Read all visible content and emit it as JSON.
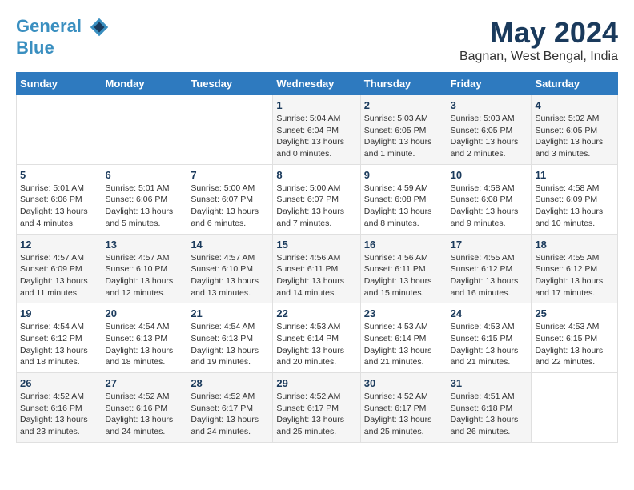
{
  "header": {
    "logo_line1": "General",
    "logo_line2": "Blue",
    "main_title": "May 2024",
    "subtitle": "Bagnan, West Bengal, India"
  },
  "weekdays": [
    "Sunday",
    "Monday",
    "Tuesday",
    "Wednesday",
    "Thursday",
    "Friday",
    "Saturday"
  ],
  "weeks": [
    [
      {
        "day": "",
        "info": ""
      },
      {
        "day": "",
        "info": ""
      },
      {
        "day": "",
        "info": ""
      },
      {
        "day": "1",
        "info": "Sunrise: 5:04 AM\nSunset: 6:04 PM\nDaylight: 13 hours and 0 minutes."
      },
      {
        "day": "2",
        "info": "Sunrise: 5:03 AM\nSunset: 6:05 PM\nDaylight: 13 hours and 1 minute."
      },
      {
        "day": "3",
        "info": "Sunrise: 5:03 AM\nSunset: 6:05 PM\nDaylight: 13 hours and 2 minutes."
      },
      {
        "day": "4",
        "info": "Sunrise: 5:02 AM\nSunset: 6:05 PM\nDaylight: 13 hours and 3 minutes."
      }
    ],
    [
      {
        "day": "5",
        "info": "Sunrise: 5:01 AM\nSunset: 6:06 PM\nDaylight: 13 hours and 4 minutes."
      },
      {
        "day": "6",
        "info": "Sunrise: 5:01 AM\nSunset: 6:06 PM\nDaylight: 13 hours and 5 minutes."
      },
      {
        "day": "7",
        "info": "Sunrise: 5:00 AM\nSunset: 6:07 PM\nDaylight: 13 hours and 6 minutes."
      },
      {
        "day": "8",
        "info": "Sunrise: 5:00 AM\nSunset: 6:07 PM\nDaylight: 13 hours and 7 minutes."
      },
      {
        "day": "9",
        "info": "Sunrise: 4:59 AM\nSunset: 6:08 PM\nDaylight: 13 hours and 8 minutes."
      },
      {
        "day": "10",
        "info": "Sunrise: 4:58 AM\nSunset: 6:08 PM\nDaylight: 13 hours and 9 minutes."
      },
      {
        "day": "11",
        "info": "Sunrise: 4:58 AM\nSunset: 6:09 PM\nDaylight: 13 hours and 10 minutes."
      }
    ],
    [
      {
        "day": "12",
        "info": "Sunrise: 4:57 AM\nSunset: 6:09 PM\nDaylight: 13 hours and 11 minutes."
      },
      {
        "day": "13",
        "info": "Sunrise: 4:57 AM\nSunset: 6:10 PM\nDaylight: 13 hours and 12 minutes."
      },
      {
        "day": "14",
        "info": "Sunrise: 4:57 AM\nSunset: 6:10 PM\nDaylight: 13 hours and 13 minutes."
      },
      {
        "day": "15",
        "info": "Sunrise: 4:56 AM\nSunset: 6:11 PM\nDaylight: 13 hours and 14 minutes."
      },
      {
        "day": "16",
        "info": "Sunrise: 4:56 AM\nSunset: 6:11 PM\nDaylight: 13 hours and 15 minutes."
      },
      {
        "day": "17",
        "info": "Sunrise: 4:55 AM\nSunset: 6:12 PM\nDaylight: 13 hours and 16 minutes."
      },
      {
        "day": "18",
        "info": "Sunrise: 4:55 AM\nSunset: 6:12 PM\nDaylight: 13 hours and 17 minutes."
      }
    ],
    [
      {
        "day": "19",
        "info": "Sunrise: 4:54 AM\nSunset: 6:12 PM\nDaylight: 13 hours and 18 minutes."
      },
      {
        "day": "20",
        "info": "Sunrise: 4:54 AM\nSunset: 6:13 PM\nDaylight: 13 hours and 18 minutes."
      },
      {
        "day": "21",
        "info": "Sunrise: 4:54 AM\nSunset: 6:13 PM\nDaylight: 13 hours and 19 minutes."
      },
      {
        "day": "22",
        "info": "Sunrise: 4:53 AM\nSunset: 6:14 PM\nDaylight: 13 hours and 20 minutes."
      },
      {
        "day": "23",
        "info": "Sunrise: 4:53 AM\nSunset: 6:14 PM\nDaylight: 13 hours and 21 minutes."
      },
      {
        "day": "24",
        "info": "Sunrise: 4:53 AM\nSunset: 6:15 PM\nDaylight: 13 hours and 21 minutes."
      },
      {
        "day": "25",
        "info": "Sunrise: 4:53 AM\nSunset: 6:15 PM\nDaylight: 13 hours and 22 minutes."
      }
    ],
    [
      {
        "day": "26",
        "info": "Sunrise: 4:52 AM\nSunset: 6:16 PM\nDaylight: 13 hours and 23 minutes."
      },
      {
        "day": "27",
        "info": "Sunrise: 4:52 AM\nSunset: 6:16 PM\nDaylight: 13 hours and 24 minutes."
      },
      {
        "day": "28",
        "info": "Sunrise: 4:52 AM\nSunset: 6:17 PM\nDaylight: 13 hours and 24 minutes."
      },
      {
        "day": "29",
        "info": "Sunrise: 4:52 AM\nSunset: 6:17 PM\nDaylight: 13 hours and 25 minutes."
      },
      {
        "day": "30",
        "info": "Sunrise: 4:52 AM\nSunset: 6:17 PM\nDaylight: 13 hours and 25 minutes."
      },
      {
        "day": "31",
        "info": "Sunrise: 4:51 AM\nSunset: 6:18 PM\nDaylight: 13 hours and 26 minutes."
      },
      {
        "day": "",
        "info": ""
      }
    ]
  ]
}
